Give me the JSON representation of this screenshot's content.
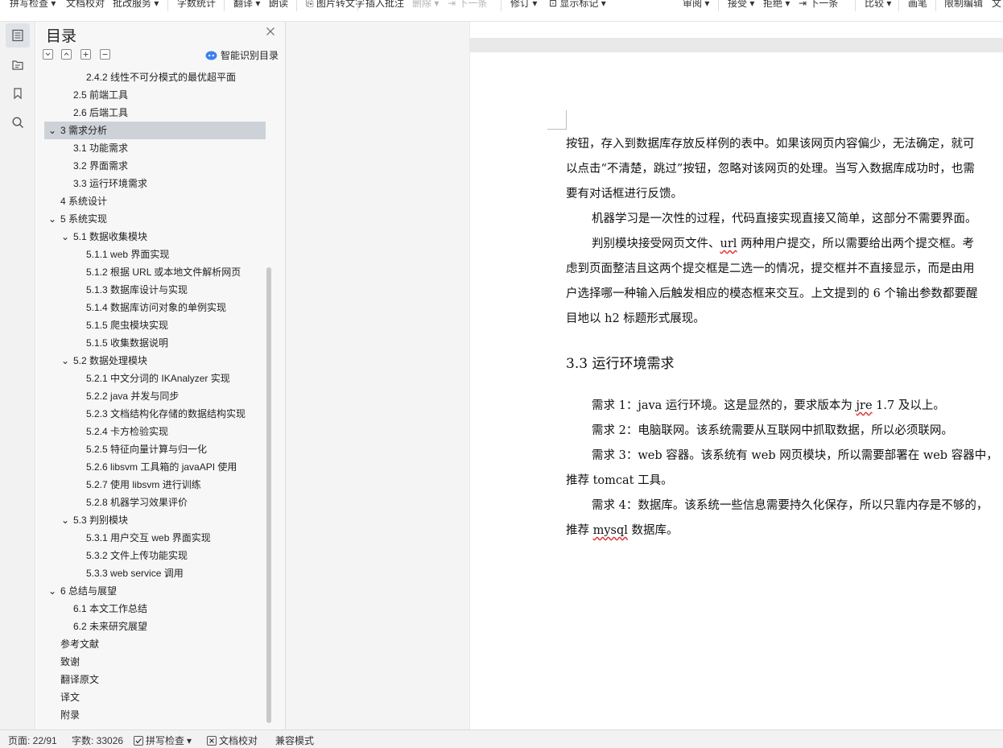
{
  "ribbon": {
    "spell_check": "拼写检查",
    "doc_proof": "文档校对",
    "batch_service": "批改服务",
    "word_count": "字数统计",
    "translate": "翻译",
    "read_aloud": "朗读",
    "image_to_text": "图片转文字",
    "insert_comment": "插入批注",
    "delete": "删除",
    "next_comment": "下一条",
    "revise": "修订",
    "show_marks": "显示标记",
    "review": "审阅",
    "accept": "接受",
    "reject": "拒绝",
    "next_change": "下一条",
    "compare": "比较",
    "ink": "画笔",
    "restrict_edit": "限制编辑",
    "doc_rights": "文"
  },
  "toc": {
    "title": "目录",
    "smart_label": "智能识别目录",
    "items": [
      {
        "label": "2.4.2 线性不可分模式的最优超平面"
      },
      {
        "label": "2.5  前端工具"
      },
      {
        "label": "2.6  后端工具"
      },
      {
        "label": "3 需求分析"
      },
      {
        "label": "3.1  功能需求"
      },
      {
        "label": "3.2  界面需求"
      },
      {
        "label": "3.3 运行环境需求"
      },
      {
        "label": "4 系统设计"
      },
      {
        "label": "5 系统实现"
      },
      {
        "label": "5.1  数据收集模块"
      },
      {
        "label": "5.1.1 web  界面实现"
      },
      {
        "label": "5.1.2  根据 URL 或本地文件解析网页"
      },
      {
        "label": "5.1.3  数据库设计与实现"
      },
      {
        "label": "5.1.4  数据库访问对象的单例实现"
      },
      {
        "label": "5.1.5  爬虫模块实现"
      },
      {
        "label": "5.1.5  收集数据说明"
      },
      {
        "label": "5.2  数据处理模块"
      },
      {
        "label": "5.2.1 中文分词的 IKAnalyzer 实现"
      },
      {
        "label": "5.2.2 java  并发与同步"
      },
      {
        "label": "5.2.3  文档结构化存储的数据结构实现"
      },
      {
        "label": "5.2.4 卡方检验实现"
      },
      {
        "label": "5.2.5  特征向量计算与归一化"
      },
      {
        "label": "5.2.6 libsvm 工具箱的 javaAPI 使用"
      },
      {
        "label": "5.2.7  使用 libsvm 进行训练"
      },
      {
        "label": "5.2.8  机器学习效果评价"
      },
      {
        "label": "5.3 判别模块"
      },
      {
        "label": "5.3.1 用户交互 web 界面实现"
      },
      {
        "label": "5.3.2  文件上传功能实现"
      },
      {
        "label": "5.3.3 web service 调用"
      },
      {
        "label": "6 总结与展望"
      },
      {
        "label": "6.1  本文工作总结"
      },
      {
        "label": "6.2  未来研究展望"
      },
      {
        "label": "参考文献"
      },
      {
        "label": "致谢"
      },
      {
        "label": "翻译原文"
      },
      {
        "label": "译文"
      },
      {
        "label": "附录"
      }
    ]
  },
  "document": {
    "l1": "按钮，存入到数据库存放反样例的表中。如果该网页内容偏少，无法确定，就可",
    "l2": "以点击“不清楚，跳过”按钮，忽略对该网页的处理。当写入数据库成功时，也需",
    "l3": "要有对话框进行反馈。",
    "l4": "机器学习是一次性的过程，代码直接实现直接又简单，这部分不需要界面。",
    "l5a": "判别模块接受网页文件、",
    "l5b": "url",
    "l5c": " 两种用户提交，所以需要给出两个提交框。考",
    "l6": "虑到页面整洁且这两个提交框是二选一的情况，提交框并不直接显示，而是由用",
    "l7": "户选择哪一种输入后触发相应的模态框来交互。上文提到的 6 个输出参数都要醒",
    "l8": "目地以 h2 标题形式展现。",
    "heading": "3.3 运行环境需求",
    "r1a": "需求 1：java 运行环境。这是显然的，要求版本为 ",
    "r1b": "jre",
    "r1c": " 1.7 及以上。",
    "r2": "需求 2：电脑联网。该系统需要从互联网中抓取数据，所以必须联网。",
    "r3": "需求 3：web 容器。该系统有 web 网页模块，所以需要部署在 web 容器中，",
    "r3b": "推荐 tomcat 工具。",
    "r4": "需求 4：数据库。该系统一些信息需要持久化保存，所以只靠内存是不够的，",
    "r4a": "推荐 ",
    "r4b": "mysql",
    "r4c": " 数据库。"
  },
  "status": {
    "page": "页面: 22/91",
    "words": "字数: 33026",
    "spell": "拼写检查",
    "proof": "文档校对",
    "compat": "兼容模式"
  }
}
